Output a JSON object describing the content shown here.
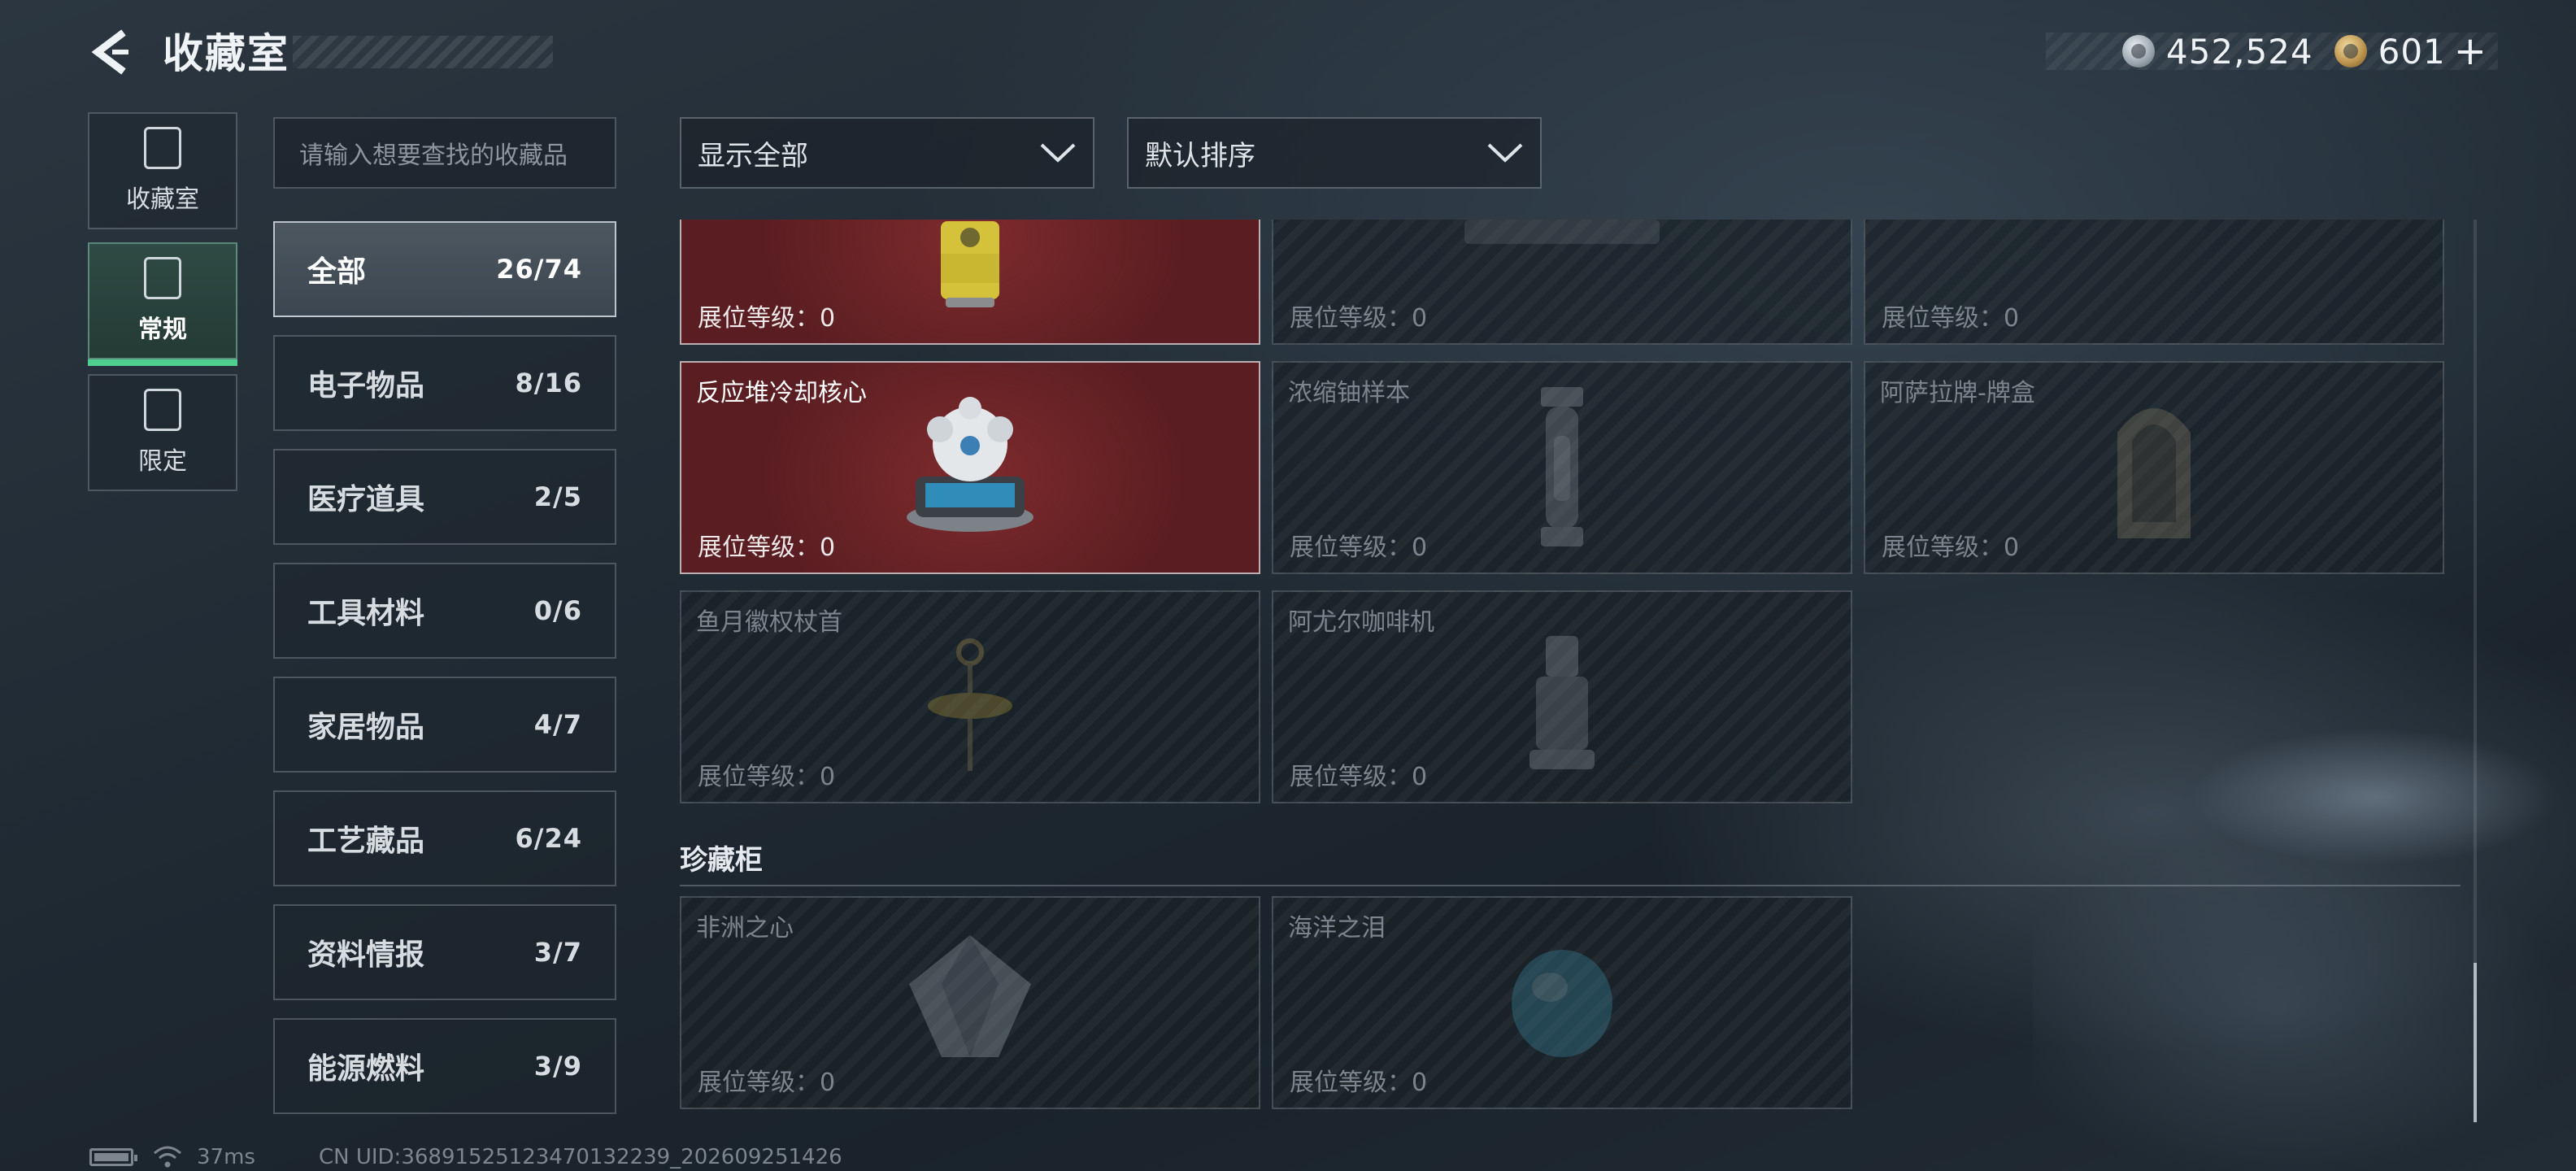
{
  "header": {
    "title": "收藏室",
    "back_icon": "back-arrow-icon",
    "currencies": [
      {
        "icon": "silver-coin-icon",
        "value": "452,524"
      },
      {
        "icon": "gold-coin-icon",
        "value": "601"
      }
    ],
    "add_icon": "plus-icon"
  },
  "rail": [
    {
      "label": "收藏室",
      "icon": "collection-room-icon",
      "active": false
    },
    {
      "label": "常规",
      "icon": "regular-icon",
      "active": true
    },
    {
      "label": "限定",
      "icon": "limited-icon",
      "active": false
    }
  ],
  "search": {
    "placeholder": "请输入想要查找的收藏品"
  },
  "filters": {
    "display": {
      "value": "显示全部",
      "icon": "chevron-down-icon"
    },
    "sort": {
      "value": "默认排序",
      "icon": "chevron-down-icon"
    }
  },
  "categories": [
    {
      "label": "全部",
      "count": "26/74",
      "active": true
    },
    {
      "label": "电子物品",
      "count": "8/16"
    },
    {
      "label": "医疗道具",
      "count": "2/5"
    },
    {
      "label": "工具材料",
      "count": "0/6"
    },
    {
      "label": "家居物品",
      "count": "4/7"
    },
    {
      "label": "工艺藏品",
      "count": "6/24"
    },
    {
      "label": "资料情报",
      "count": "3/7"
    },
    {
      "label": "能源燃料",
      "count": "3/9"
    }
  ],
  "level_label": "展位等级：",
  "items_partial": [
    {
      "name": "",
      "level": "0",
      "owned": true
    },
    {
      "name": "",
      "level": "0",
      "owned": false
    },
    {
      "name": "",
      "level": "0",
      "owned": false
    }
  ],
  "items": [
    {
      "name": "反应堆冷却核心",
      "level": "0",
      "owned": true
    },
    {
      "name": "浓缩铀样本",
      "level": "0",
      "owned": false
    },
    {
      "name": "阿萨拉牌-牌盒",
      "level": "0",
      "owned": false
    },
    {
      "name": "鱼月徽权杖首",
      "level": "0",
      "owned": false
    },
    {
      "name": "阿尤尔咖啡机",
      "level": "0",
      "owned": false
    }
  ],
  "cabinet": {
    "title": "珍藏柜",
    "items": [
      {
        "name": "非洲之心",
        "level": "0",
        "owned": false
      },
      {
        "name": "海洋之泪",
        "level": "0",
        "owned": false
      }
    ]
  },
  "footer": {
    "latency": "37ms",
    "uid": "CN UID:3689152512347013223​9_202609251426"
  },
  "colors": {
    "accent_green": "#4fce8f",
    "owned_card": "#5a1e22",
    "background": "#1c252e"
  }
}
